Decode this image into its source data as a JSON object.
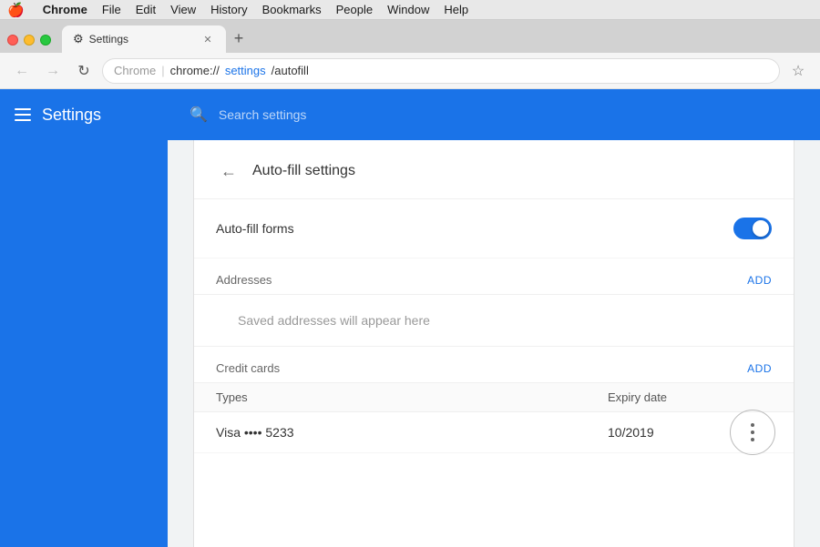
{
  "titlebar": {
    "apple": "🍎",
    "menu_items": [
      "Chrome",
      "File",
      "Edit",
      "View",
      "History",
      "Bookmarks",
      "People",
      "Window",
      "Help"
    ]
  },
  "tab": {
    "icon": "⚙",
    "label": "Settings",
    "close": "✕"
  },
  "navbar": {
    "back": "←",
    "forward": "→",
    "reload": "↻",
    "chrome_label": "Chrome",
    "separator": "|",
    "url_prefix": "chrome://",
    "url_bold": "settings",
    "url_suffix": "/autofill",
    "bookmark": "☆"
  },
  "sidebar": {
    "title": "Settings"
  },
  "search": {
    "placeholder": "Search settings"
  },
  "page": {
    "back_arrow": "←",
    "title": "Auto-fill settings"
  },
  "autofill_forms": {
    "label": "Auto-fill forms",
    "toggle_on": true
  },
  "addresses": {
    "label": "Addresses",
    "add_label": "ADD",
    "empty_message": "Saved addresses will appear here"
  },
  "credit_cards": {
    "label": "Credit cards",
    "add_label": "ADD",
    "columns": {
      "types": "Types",
      "expiry": "Expiry date"
    },
    "cards": [
      {
        "name": "Visa •••• 5233",
        "expiry": "10/2019"
      }
    ]
  }
}
